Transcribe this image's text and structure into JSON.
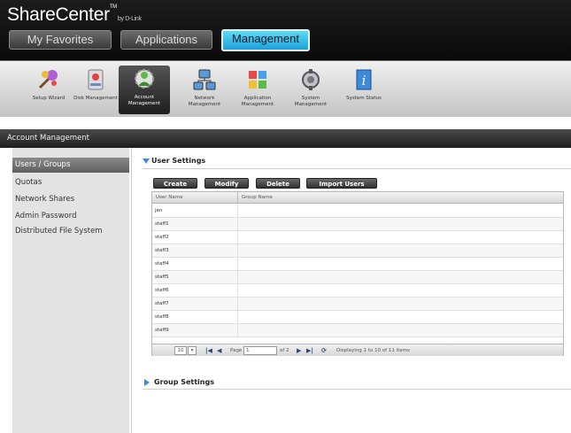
{
  "app": {
    "brand_main": "ShareCenter",
    "brand_tm": "TM",
    "brand_by": "by D-Link"
  },
  "tabs": [
    {
      "label": "My Favorites",
      "active": false
    },
    {
      "label": "Applications",
      "active": false
    },
    {
      "label": "Management",
      "active": true
    }
  ],
  "toolbar": [
    {
      "label": "Setup Wizard",
      "icon": "wizard-icon",
      "active": false
    },
    {
      "label": "Disk Management",
      "icon": "disk-icon",
      "active": false
    },
    {
      "label": "Account Management",
      "icon": "account-icon",
      "active": true
    },
    {
      "label": "Network Management",
      "icon": "network-icon",
      "active": false
    },
    {
      "label": "Application Management",
      "icon": "application-icon",
      "active": false
    },
    {
      "label": "System Management",
      "icon": "system-icon",
      "active": false
    },
    {
      "label": "System Status",
      "icon": "info-icon",
      "active": false
    }
  ],
  "section_title": "Account Management",
  "sidebar": [
    {
      "label": "Users / Groups",
      "active": true
    },
    {
      "label": "Quotas",
      "active": false
    },
    {
      "label": "Network Shares",
      "active": false
    },
    {
      "label": "Admin Password",
      "active": false
    },
    {
      "label": "Distributed File System",
      "active": false
    }
  ],
  "user_settings": {
    "title": "User Settings",
    "buttons": [
      "Create",
      "Modify",
      "Delete",
      "Import Users"
    ],
    "columns": [
      "User Name",
      "Group Name"
    ],
    "rows": [
      "jen",
      "staff1",
      "staff2",
      "staff3",
      "staff4",
      "staff5",
      "staff6",
      "staff7",
      "staff8",
      "staff9"
    ]
  },
  "pager": {
    "page_size": "10",
    "page_label": "Page",
    "page_value": "1",
    "of_label": "of 2",
    "displaying": "Displaying 1 to 10 of 11 items"
  },
  "group_settings": {
    "title": "Group Settings"
  },
  "colors": {
    "accent": "#3d8bd8",
    "active_tab": "#1ea0d8"
  }
}
